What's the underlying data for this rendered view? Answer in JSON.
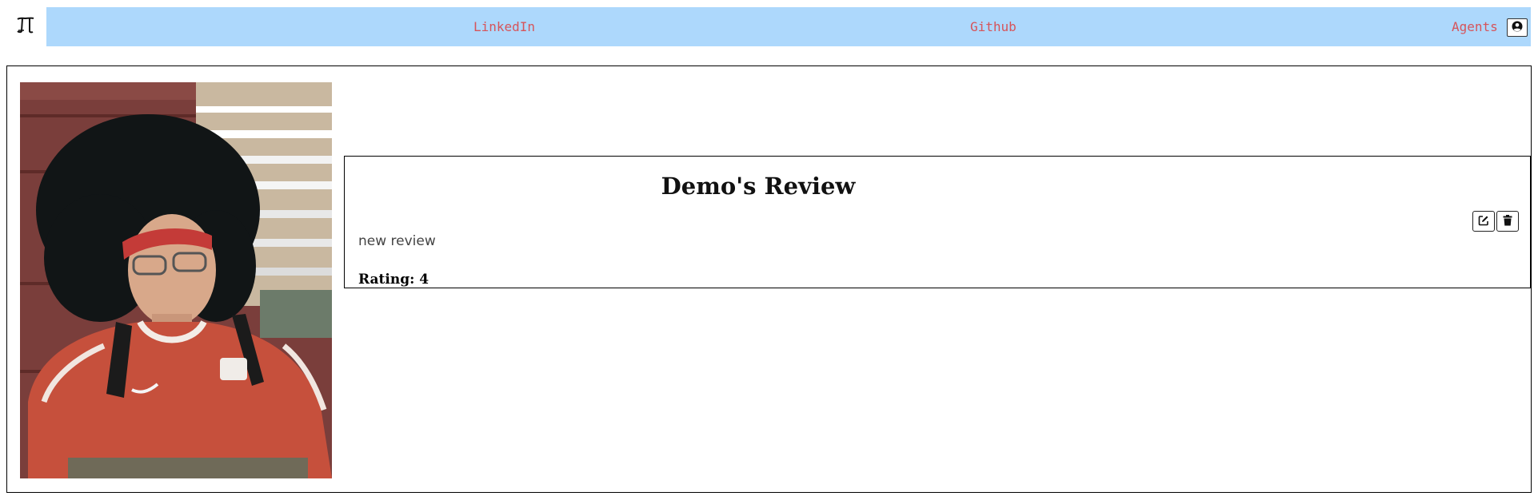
{
  "nav": {
    "links": [
      {
        "label": "LinkedIn"
      },
      {
        "label": "Github"
      },
      {
        "label": "Agents"
      }
    ],
    "link_color": "#d6545a",
    "bar_color": "#add8fc"
  },
  "icons": {
    "logo": "logo-icon",
    "account": "user-circle-icon",
    "edit": "edit-icon",
    "delete": "trash-icon"
  },
  "review": {
    "title": "Demo's Review",
    "body": "new review",
    "rating": "Rating: 4"
  }
}
